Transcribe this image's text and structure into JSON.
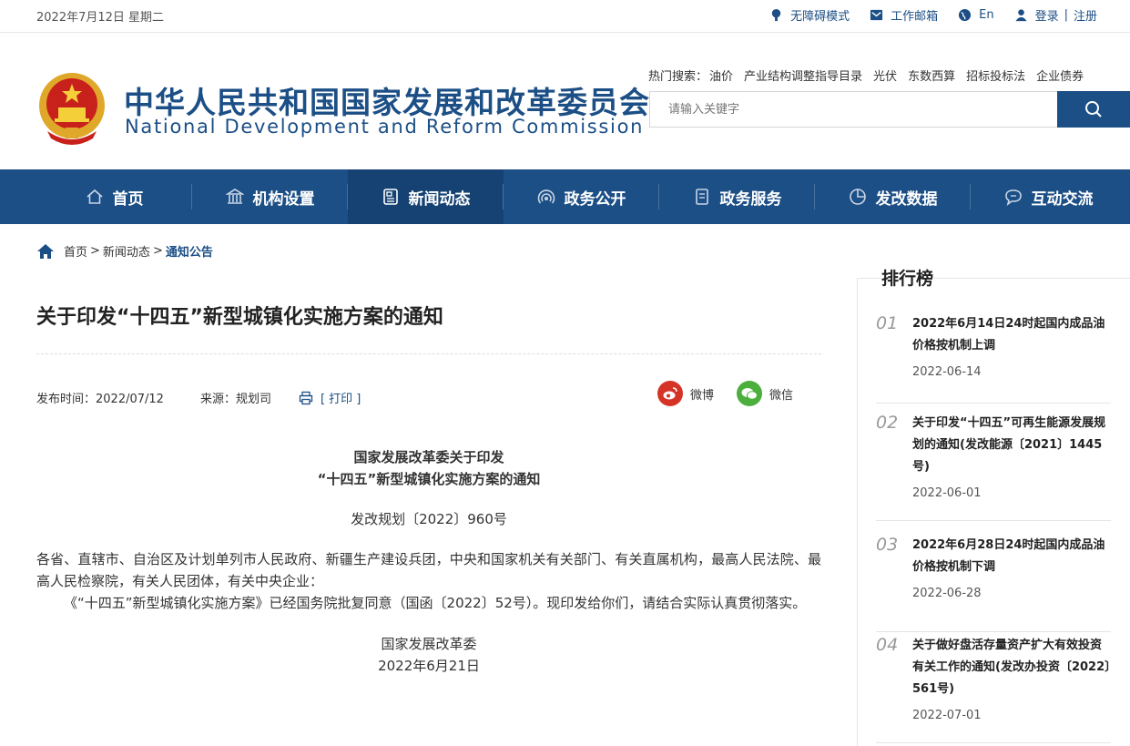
{
  "topbar": {
    "date": "2022年7月12日 星期二",
    "accessibility": "无障碍模式",
    "mail": "工作邮箱",
    "lang": "En",
    "login": "登录",
    "register": "注册"
  },
  "header": {
    "cn_title": "中华人民共和国国家发展和改革委员会",
    "en_title": "National Development and Reform Commission",
    "hot_label": "热门搜索：",
    "hot_terms": [
      "油价",
      "产业结构调整指导目录",
      "光伏",
      "东数西算",
      "招标投标法",
      "企业债券"
    ],
    "search_placeholder": "请输入关键字"
  },
  "nav": [
    {
      "label": "首页",
      "icon": "home-icon"
    },
    {
      "label": "机构设置",
      "icon": "building-icon"
    },
    {
      "label": "新闻动态",
      "icon": "news-icon",
      "active": true
    },
    {
      "label": "政务公开",
      "icon": "broadcast-icon"
    },
    {
      "label": "政务服务",
      "icon": "document-icon"
    },
    {
      "label": "发改数据",
      "icon": "pie-chart-icon"
    },
    {
      "label": "互动交流",
      "icon": "chat-icon"
    }
  ],
  "breadcrumb": {
    "home": "首页",
    "sep": ">",
    "news": "新闻动态",
    "current": "通知公告"
  },
  "article": {
    "title": "关于印发“十四五”新型城镇化实施方案的通知",
    "publish": "发布时间：2022/07/12",
    "source": "来源：规划司",
    "print": "[ 打印 ]",
    "weibo": "微博",
    "wechat": "微信",
    "head1": "国家发展改革委关于印发",
    "head2": "“十四五”新型城镇化实施方案的通知",
    "doc_no": "发改规划〔2022〕960号",
    "para1": "各省、直辖市、自治区及计划单列市人民政府、新疆生产建设兵团，中央和国家机关有关部门、有关直属机构，最高人民法院、最高人民检察院，有关人民团体，有关中央企业：",
    "para2": "《“十四五”新型城镇化实施方案》已经国务院批复同意（国函〔2022〕52号）。现印发给你们，请结合实际认真贯彻落实。",
    "sign_org": "国家发展改革委",
    "sign_date": "2022年6月21日"
  },
  "ranking": {
    "title": "排行榜",
    "items": [
      {
        "num": "01",
        "title": "2022年6月14日24时起国内成品油价格按机制上调",
        "date": "2022-06-14"
      },
      {
        "num": "02",
        "title": "关于印发“十四五”可再生能源发展规划的通知(发改能源〔2021〕1445号)",
        "date": "2022-06-01"
      },
      {
        "num": "03",
        "title": "2022年6月28日24时起国内成品油价格按机制下调",
        "date": "2022-06-28"
      },
      {
        "num": "04",
        "title": "关于做好盘活存量资产扩大有效投资有关工作的通知(发改办投资〔2022〕561号)",
        "date": "2022-07-01"
      }
    ]
  },
  "colors": {
    "brand": "#1c4f86",
    "nav_active": "#154273",
    "weibo": "#d63327",
    "wechat": "#4caf3d"
  }
}
